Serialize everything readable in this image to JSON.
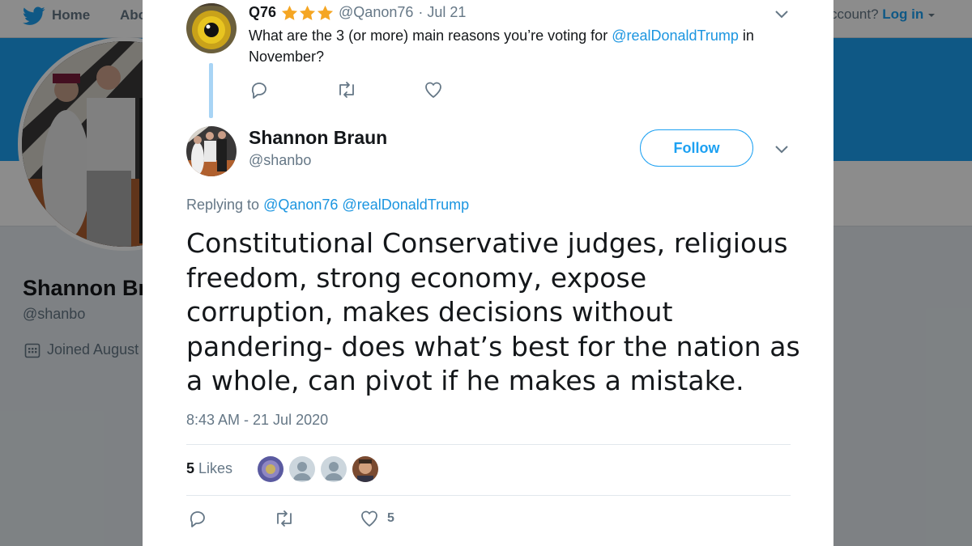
{
  "background_page": {
    "nav": {
      "home_label": "Home",
      "about_label": "Abo"
    },
    "login_prompt": "ccount?",
    "login_label": "Log in",
    "profile_name": "Shannon Bra",
    "profile_handle": "@shanbo",
    "joined_label": "Joined August"
  },
  "parent_tweet": {
    "name": "Q76",
    "handle": "@Qanon76",
    "date": "· Jul 21",
    "text_before": "What are the 3 (or more) main reasons you’re voting for ",
    "mention": "@realDonaldTrump",
    "text_after": " in November?"
  },
  "main_tweet": {
    "name": "Shannon Braun",
    "handle": "@shanbo",
    "follow_label": "Follow",
    "replying_label": "Replying to",
    "replying_mentions": "@Qanon76 @realDonaldTrump",
    "text": "Constitutional Conservative judges, religious freedom, strong economy, expose corruption, makes decisions without pandering- does what’s best for the nation as a whole, can pivot if he makes a mistake.",
    "timestamp": "8:43 AM - 21 Jul 2020",
    "likes_count": "5",
    "likes_label": "Likes",
    "footer_like_count": "5"
  },
  "colors": {
    "accent": "#1da1f2",
    "link": "#1b95e0",
    "star": "#f5a623",
    "muted": "#657786",
    "text": "#14171a"
  },
  "icons": [
    "twitter-bird-icon",
    "reply-icon",
    "retweet-icon",
    "heart-icon",
    "chevron-down-icon",
    "calendar-icon",
    "star-icon"
  ]
}
